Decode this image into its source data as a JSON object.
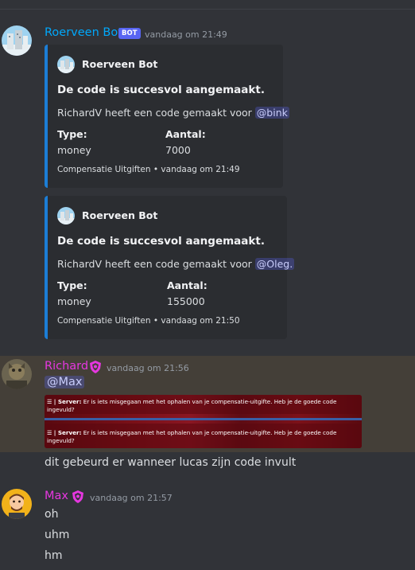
{
  "messages": [
    {
      "author": "Roerveen Bot",
      "badge": "BOT",
      "timestamp": "vandaag om 21:49",
      "author_color": "#00a8fc",
      "embeds": [
        {
          "author": "Roerveen Bot",
          "title": "De code is succesvol aangemaakt.",
          "description_prefix": "RichardV heeft een code gemaakt voor",
          "mention": "@bink",
          "fields": [
            {
              "name": "Type:",
              "value": "money"
            },
            {
              "name": "Aantal:",
              "value": "7000"
            }
          ],
          "footer": "Compensatie Uitgiften • vandaag om 21:49"
        },
        {
          "author": "Roerveen Bot",
          "title": "De code is succesvol aangemaakt.",
          "description_prefix": "RichardV heeft een code gemaakt voor",
          "mention": "@Oleg.",
          "fields": [
            {
              "name": "Type:",
              "value": "money"
            },
            {
              "name": "Aantal:",
              "value": "155000"
            }
          ],
          "footer": "Compensatie Uitgiften • vandaag om 21:50"
        }
      ]
    },
    {
      "author": "Richard",
      "timestamp": "vandaag om 21:56",
      "author_color": "#e637e0",
      "role_icon": "shield-icon",
      "mention": "@Max",
      "attachment_lines": [
        {
          "label": "| Server:",
          "text": "Er is iets misgegaan met het ophalen van je compensatie-uitgifte. Heb je de goede code ingevuld?"
        },
        {
          "label": "| Server:",
          "text": "Er is iets misgegaan met het ophalen van je compensatie-uitgifte. Heb je de goede code ingevuld?"
        }
      ],
      "text": "dit gebeurd er wanneer lucas zijn code invult"
    },
    {
      "author": "Max",
      "timestamp": "vandaag om 21:57",
      "author_color": "#e637e0",
      "role_icon": "shield-icon",
      "lines": [
        "oh",
        "uhm",
        "hm"
      ]
    }
  ]
}
